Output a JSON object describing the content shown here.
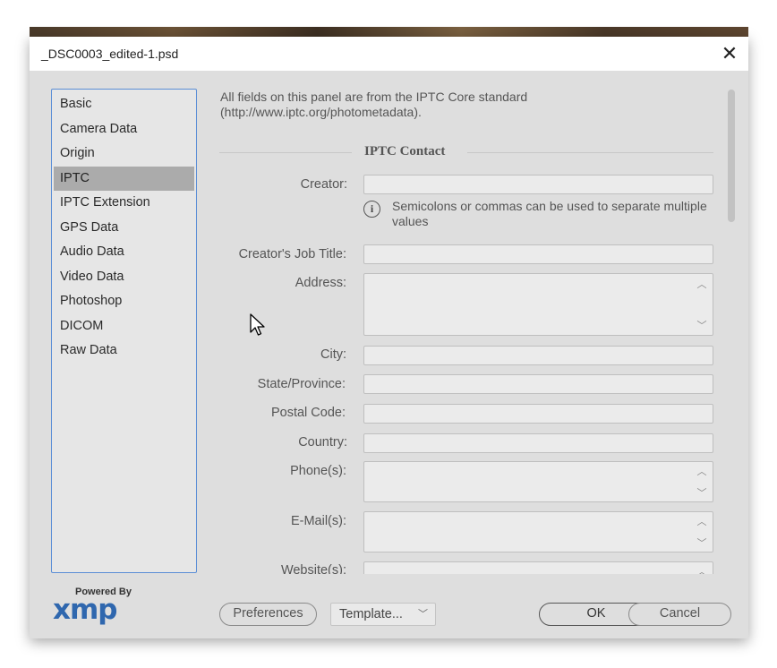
{
  "window": {
    "title": "_DSC0003_edited-1.psd",
    "close_glyph": "✕"
  },
  "sidebar": {
    "items": [
      {
        "label": "Basic"
      },
      {
        "label": "Camera Data"
      },
      {
        "label": "Origin"
      },
      {
        "label": "IPTC",
        "active": true
      },
      {
        "label": "IPTC Extension"
      },
      {
        "label": "GPS Data"
      },
      {
        "label": "Audio Data"
      },
      {
        "label": "Video Data"
      },
      {
        "label": "Photoshop"
      },
      {
        "label": "DICOM"
      },
      {
        "label": "Raw Data"
      }
    ]
  },
  "panel": {
    "intro": "All fields on this panel are from the IPTC Core standard (http://www.iptc.org/photometadata).",
    "section_title": "IPTC Contact",
    "creator_label": "Creator:",
    "creator_value": "",
    "hint_icon": "i",
    "hint_text": "Semicolons or commas can be used to separate multiple values",
    "job_title_label": "Creator's Job Title:",
    "job_title_value": "",
    "address_label": "Address:",
    "city_label": "City:",
    "state_label": "State/Province:",
    "postal_label": "Postal Code:",
    "country_label": "Country:",
    "phone_label": "Phone(s):",
    "email_label": "E-Mail(s):",
    "website_label": "Website(s):",
    "spin_up": "︿",
    "spin_down": "﹀"
  },
  "footer": {
    "powered_by": "Powered By",
    "logo_text": "xmp",
    "preferences_label": "Preferences",
    "template_label": "Template...",
    "template_chevron": "﹀",
    "ok_label": "OK",
    "cancel_label": "Cancel"
  },
  "colors": {
    "dialog_bg": "#dedede",
    "sidebar_active": "#ababab",
    "sidebar_border": "#5b8ed6",
    "xmp_blue": "#2f67ae"
  }
}
